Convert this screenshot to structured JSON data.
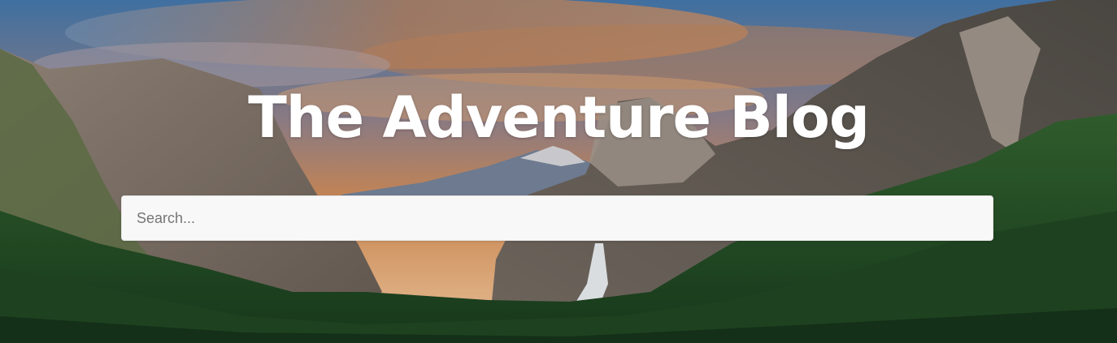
{
  "header": {
    "title": "The Adventure Blog"
  },
  "search": {
    "placeholder": "Search...",
    "value": ""
  },
  "background": {
    "description_icon": "mountain-valley-image",
    "sky_colors": [
      "#3f6fa0",
      "#c98550",
      "#e7b98a"
    ],
    "rock_color": "#7a6c62",
    "forest_color": "#1f4a24"
  }
}
